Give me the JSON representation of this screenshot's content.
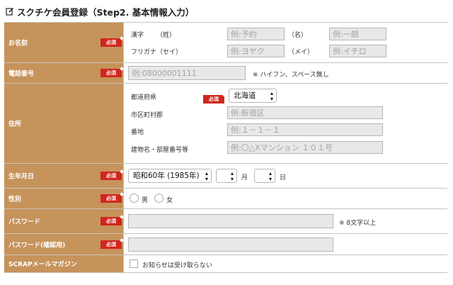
{
  "page_title": "スクチケ会員登録（Step2. 基本情報入力）",
  "required_label": "必須",
  "name": {
    "label": "お名前",
    "kanji": "漢字",
    "sei": "（姓）",
    "mei": "（名）",
    "furigana": "フリガナ（セイ）",
    "furigana_mei": "（メイ）",
    "sei_placeholder": "例:予約",
    "mei_placeholder": "例:一朗",
    "sei_kana_placeholder": "例:ヨヤク",
    "mei_kana_placeholder": "例:イチロ"
  },
  "phone": {
    "label": "電話番号",
    "placeholder": "例:08000001111",
    "note": "※ ハイフン、スペース無し"
  },
  "address": {
    "label": "住所",
    "prefecture": "都道府県",
    "prefecture_value": "北海道",
    "city": "市区町村郡",
    "city_placeholder": "例:新宿区",
    "street": "番地",
    "street_placeholder": "例:１－１－１",
    "building": "建物名・部屋番号等",
    "building_placeholder": "例:〇△Xマンション １０１号"
  },
  "birthday": {
    "label": "生年月日",
    "year_value": "昭和60年 (1985年)",
    "month_unit": "月",
    "day_unit": "日"
  },
  "gender": {
    "label": "性別",
    "male": "男",
    "female": "女"
  },
  "password": {
    "label": "パスワード",
    "note": "※ 8文字以上"
  },
  "password_confirm": {
    "label": "パスワード(確認用)"
  },
  "magazine": {
    "label": "SCRAPメールマガジン",
    "checkbox_label": "お知らせは受け取らない"
  }
}
